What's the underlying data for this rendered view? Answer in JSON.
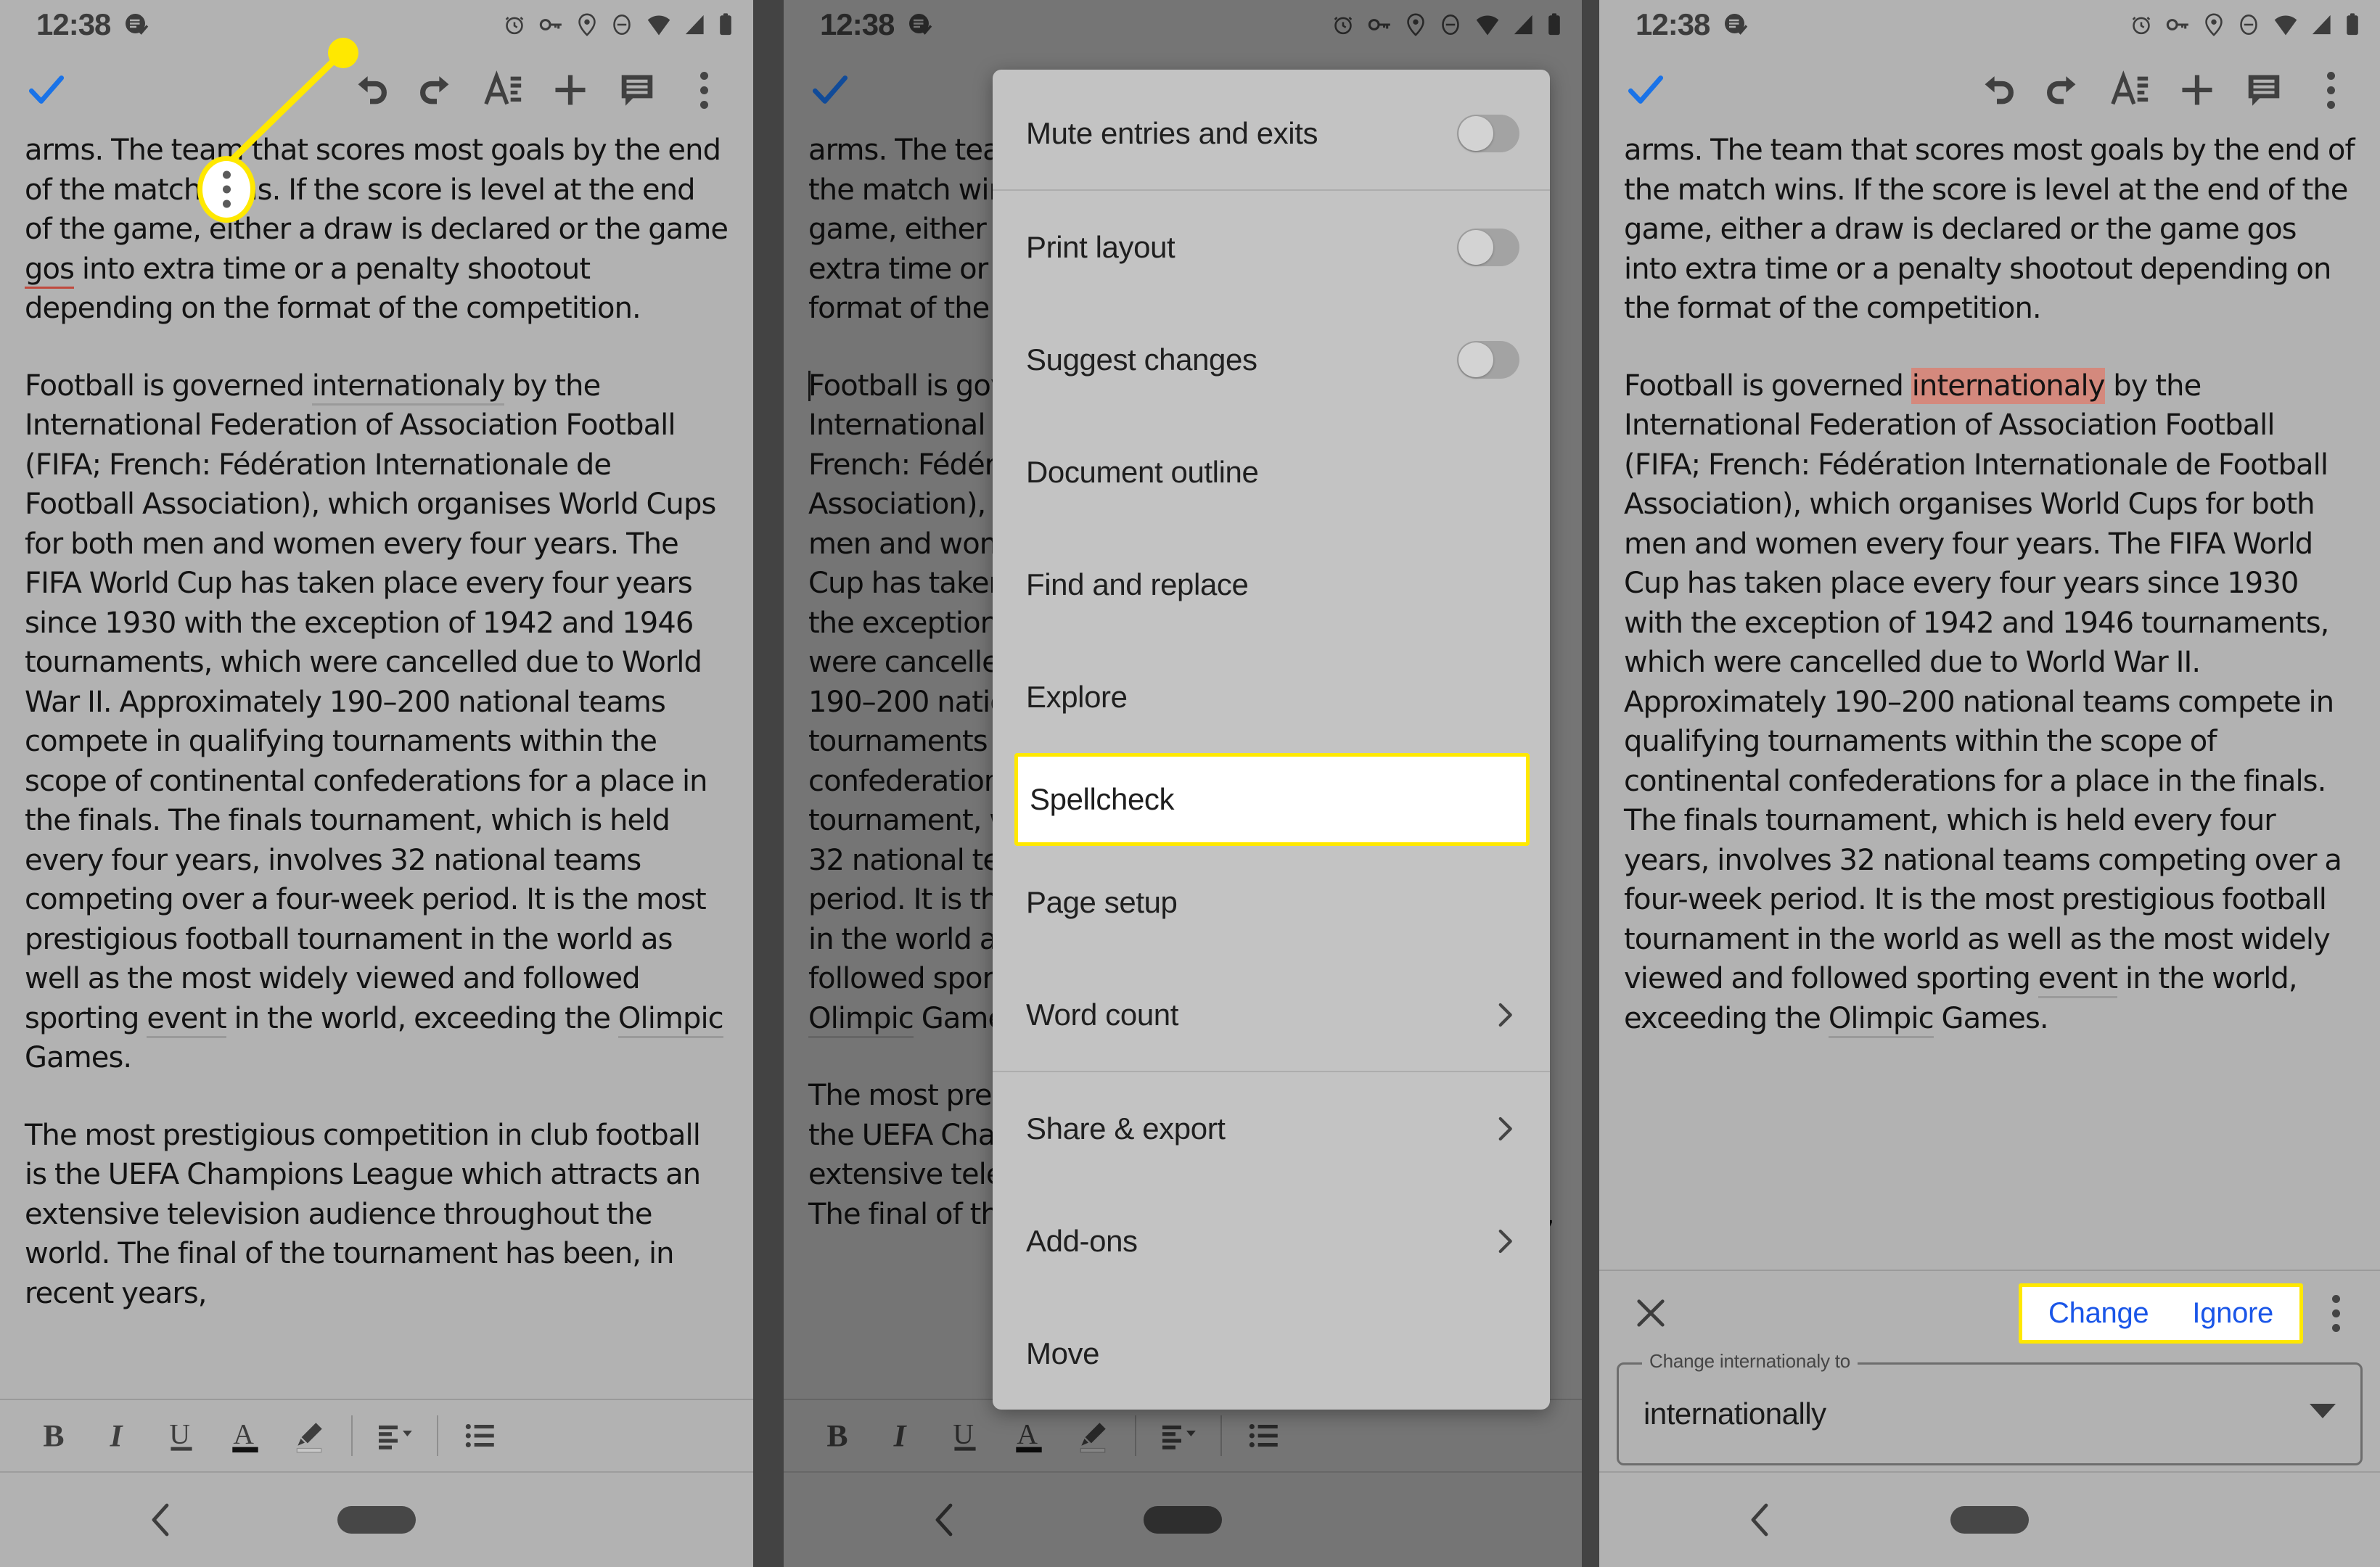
{
  "status_bar": {
    "time": "12:38",
    "left_icons": [
      "app-badge-icon"
    ],
    "right_icons": [
      "alarm-icon",
      "key-icon",
      "location-icon",
      "do-not-disturb-icon",
      "wifi-icon",
      "signal-icon",
      "battery-icon"
    ]
  },
  "toolbar": {
    "done_label": "done-check",
    "items": [
      "undo-icon",
      "redo-icon",
      "format-text-icon",
      "insert-add-icon",
      "comment-icon",
      "overflow-menu-icon"
    ]
  },
  "document": {
    "paragraph_1_pre": "arms. The team that scores most goals by the end of the match wins. If the score is level at the end of the game, either a draw is declared or the game ",
    "paragraph_1_misspelled": "gos",
    "paragraph_1_post": " into extra time or a penalty shootout depending on the format of the competition.",
    "paragraph_2_pre": "Football is governed ",
    "paragraph_2_misspelled": "internationaly",
    "paragraph_2_post": " by the International Federation of Association Football (FIFA; French: Fédération Internationale de Football Association), which organises World Cups for both men and women every four years. The FIFA World Cup has taken place every four years since 1930 with the exception of 1942 and 1946 tournaments, which were cancelled due to World War II. Approximately 190–200 national teams compete in qualifying tournaments within the scope of continental confederations for a place in the finals. The finals tournament, which is held every four years, involves 32 national teams competing over a four-week period. It is the most prestigious football tournament in the world as well as the most widely viewed and followed sporting ",
    "paragraph_2_misspelled_2": "event",
    "paragraph_2_post_2": " in the world, exceeding the ",
    "paragraph_2_misspelled_3": "Olimpic",
    "paragraph_2_post_3": " Games.",
    "paragraph_3": "The most prestigious competition in club football is the UEFA Champions League which attracts an extensive television audience throughout the world. The final of the tournament has been, in recent years,"
  },
  "format_bar": {
    "items": [
      "bold-icon",
      "italic-icon",
      "underline-icon",
      "text-color-icon",
      "highlight-icon",
      "align-icon",
      "bulleted-list-icon"
    ]
  },
  "nav_bar": {
    "back_label": "back-icon",
    "home_label": "home-pill"
  },
  "menu": {
    "items": [
      {
        "label": "Mute entries and exits",
        "type": "toggle",
        "value": "off"
      },
      {
        "label": "Print layout",
        "type": "toggle",
        "value": "off"
      },
      {
        "label": "Suggest changes",
        "type": "toggle",
        "value": "off"
      },
      {
        "label": "Document outline",
        "type": "plain"
      },
      {
        "label": "Find and replace",
        "type": "plain"
      },
      {
        "label": "Explore",
        "type": "plain"
      },
      {
        "label": "Spellcheck",
        "type": "plain",
        "highlighted": true
      },
      {
        "label": "Page setup",
        "type": "plain"
      },
      {
        "label": "Word count",
        "type": "submenu"
      },
      {
        "label": "Share & export",
        "type": "submenu"
      },
      {
        "label": "Add-ons",
        "type": "submenu"
      },
      {
        "label": "Move",
        "type": "plain"
      }
    ]
  },
  "spellcheck": {
    "close_label": "close-icon",
    "change_label": "Change",
    "ignore_label": "Ignore",
    "overflow_label": "overflow-menu-icon",
    "field_label": "Change internationaly to",
    "field_value": "internationally"
  },
  "colors": {
    "panel_bg": "#b2b2b2",
    "divider": "#434343",
    "accent_blue": "#1a73e8",
    "link_blue": "#1a56e8",
    "highlight_yellow": "#ffe800",
    "misspell_highlight": "#d4897d",
    "menu_bg": "#c3c3c3"
  }
}
